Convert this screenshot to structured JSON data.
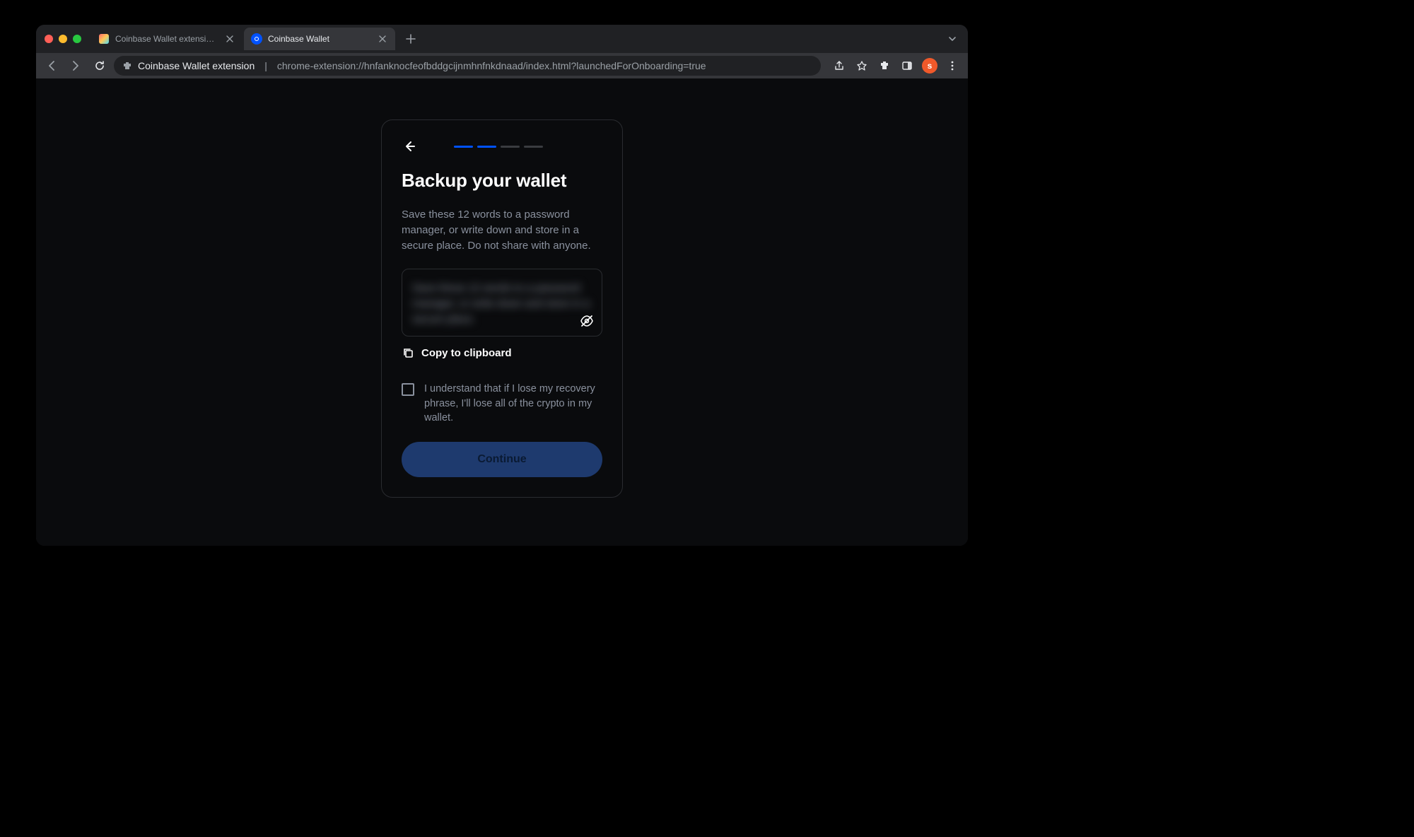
{
  "tabs": [
    {
      "title": "Coinbase Wallet extension - Ch"
    },
    {
      "title": "Coinbase Wallet"
    }
  ],
  "address": {
    "main": "Coinbase Wallet extension",
    "rest": "chrome-extension://hnfanknocfeofbddgcijnmhnfnkdnaad/index.html?launchedForOnboarding=true"
  },
  "avatar_letter": "s",
  "card": {
    "title": "Backup your wallet",
    "desc": "Save these 12 words to a password manager, or write down and store in a secure place. Do not share with anyone.",
    "seed_placeholder": "Save these 12 words to a password manager, or write down and store in a secure place.",
    "copy_label": "Copy to clipboard",
    "ack_text": "I understand that if I lose my recovery phrase, I'll lose all of the crypto in my wallet.",
    "continue_label": "Continue"
  },
  "progress": {
    "total": 4,
    "completed": 2
  }
}
